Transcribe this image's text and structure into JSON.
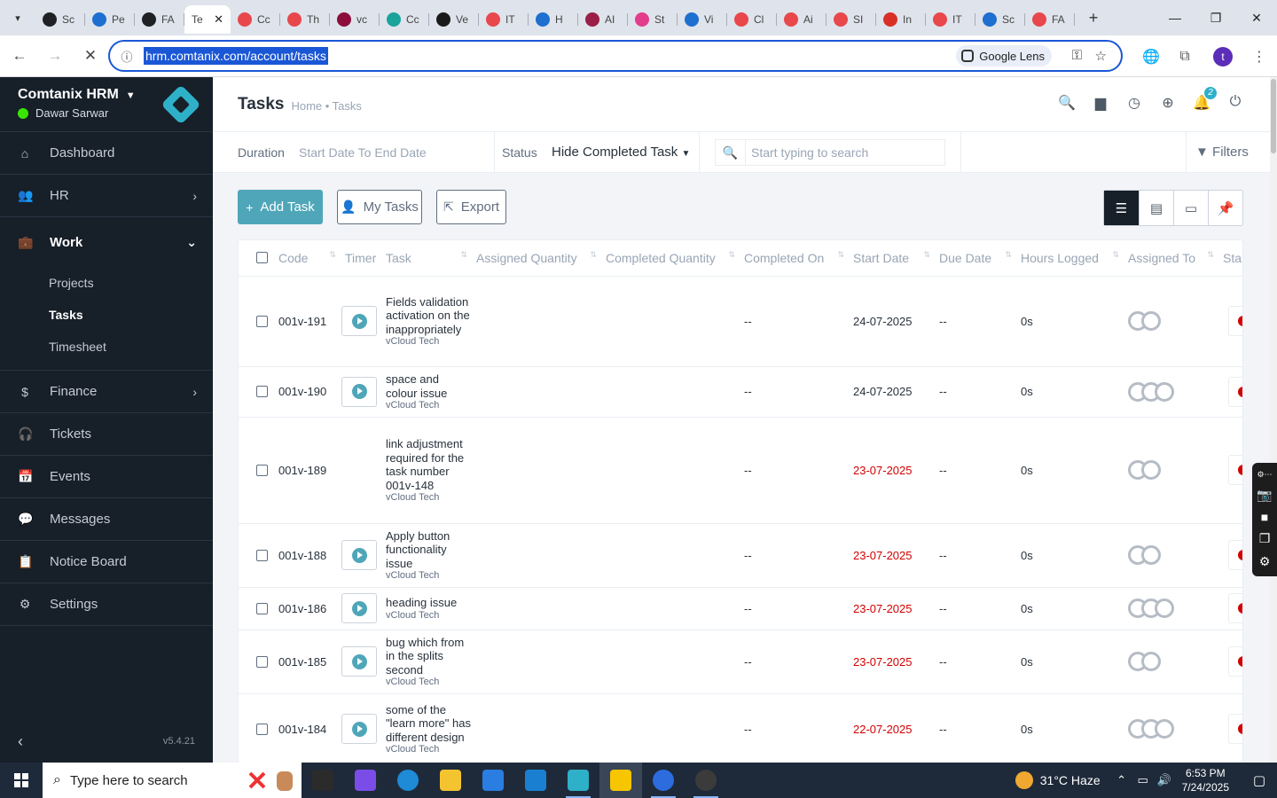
{
  "browser": {
    "active_tab_label": "Te",
    "tabs": [
      "Sc",
      "Pe",
      "FA",
      "Te",
      "Cc",
      "Th",
      "vc",
      "Cc",
      "Ve",
      "IT",
      "H",
      "AI",
      "St",
      "Vi",
      "Cl",
      "Ai",
      "SI",
      "In",
      "IT",
      "Sc",
      "FA"
    ],
    "tab_colors": [
      "#202124",
      "#1e6fd0",
      "#202124",
      "#ffffff",
      "#e8474c",
      "#e8474c",
      "#8b0f3a",
      "#1aa39a",
      "#1a1a1a",
      "#e8474c",
      "#1e6fd0",
      "#9b1e46",
      "#e33c8d",
      "#1e6fd0",
      "#e8474c",
      "#e8474c",
      "#e8474c",
      "#d93025",
      "#e8474c",
      "#1e6fd0",
      "#e8474c"
    ],
    "url": "hrm.comtanix.com/account/tasks",
    "lens_label": "Google Lens",
    "profile_initial": "t"
  },
  "sidebar": {
    "company": "Comtanix HRM",
    "user": "Dawar Sarwar",
    "items": [
      {
        "label": "Dashboard",
        "icon": "⌂"
      },
      {
        "label": "HR",
        "icon": "👥"
      },
      {
        "label": "Work",
        "icon": "💼"
      },
      {
        "label": "Finance",
        "icon": "$"
      },
      {
        "label": "Tickets",
        "icon": "🎧"
      },
      {
        "label": "Events",
        "icon": "📅"
      },
      {
        "label": "Messages",
        "icon": "💬"
      },
      {
        "label": "Notice Board",
        "icon": "📋"
      },
      {
        "label": "Settings",
        "icon": "⚙"
      }
    ],
    "work_sub": [
      "Projects",
      "Tasks",
      "Timesheet"
    ],
    "version": "v5.4.21"
  },
  "header": {
    "title": "Tasks",
    "breadcrumb": "Home • Tasks",
    "notification_count": "2"
  },
  "filters": {
    "duration_label": "Duration",
    "duration_value": "Start Date To End Date",
    "status_label": "Status",
    "status_value": "Hide Completed Task",
    "search_placeholder": "Start typing to search",
    "filters_label": "Filters"
  },
  "actions": {
    "add_task": "Add Task",
    "my_tasks": "My Tasks",
    "export": "Export"
  },
  "table": {
    "columns": [
      "Code",
      "Timer",
      "Task",
      "Assigned Quantity",
      "Completed Quantity",
      "Completed On",
      "Start Date",
      "Due Date",
      "Hours Logged",
      "Assigned To",
      "Sta"
    ],
    "rows": [
      {
        "code": "001v-191",
        "task": "Fields validation activation on the inappropriately",
        "project": "vCloud Tech",
        "completed_on": "--",
        "start_date": "24-07-2025",
        "overdue": false,
        "due_date": "--",
        "hours": "0s",
        "avatars": 2,
        "timer": true
      },
      {
        "code": "001v-190",
        "task": "space and colour issue",
        "project": "vCloud Tech",
        "completed_on": "--",
        "start_date": "24-07-2025",
        "overdue": false,
        "due_date": "--",
        "hours": "0s",
        "avatars": 3,
        "timer": true
      },
      {
        "code": "001v-189",
        "task": "link adjustment required for the task number 001v-148",
        "project": "vCloud Tech",
        "completed_on": "--",
        "start_date": "23-07-2025",
        "overdue": true,
        "due_date": "--",
        "hours": "0s",
        "avatars": 2,
        "timer": false
      },
      {
        "code": "001v-188",
        "task": "Apply button functionality issue",
        "project": "vCloud Tech",
        "completed_on": "--",
        "start_date": "23-07-2025",
        "overdue": true,
        "due_date": "--",
        "hours": "0s",
        "avatars": 2,
        "timer": true
      },
      {
        "code": "001v-186",
        "task": "heading issue",
        "project": "vCloud Tech",
        "completed_on": "--",
        "start_date": "23-07-2025",
        "overdue": true,
        "due_date": "--",
        "hours": "0s",
        "avatars": 3,
        "timer": true
      },
      {
        "code": "001v-185",
        "task": "bug which from in the splits second",
        "project": "vCloud Tech",
        "completed_on": "--",
        "start_date": "23-07-2025",
        "overdue": true,
        "due_date": "--",
        "hours": "0s",
        "avatars": 2,
        "timer": true
      },
      {
        "code": "001v-184",
        "task": "some of the \"learn more\" has different design",
        "project": "vCloud Tech",
        "completed_on": "--",
        "start_date": "22-07-2025",
        "overdue": true,
        "due_date": "--",
        "hours": "0s",
        "avatars": 3,
        "timer": true
      }
    ]
  },
  "taskbar": {
    "search_placeholder": "Type here to search",
    "weather": "31°C Haze",
    "time": "6:53 PM",
    "date": "7/24/2025",
    "app_colors": [
      "#2b2b2b",
      "#7a4de8",
      "#1f8ad6",
      "#f4c430",
      "#2a7de1",
      "#1a7fd0",
      "#2db0c8",
      "#f7c600",
      "#2d6cdf",
      "#3b3b3b"
    ]
  }
}
